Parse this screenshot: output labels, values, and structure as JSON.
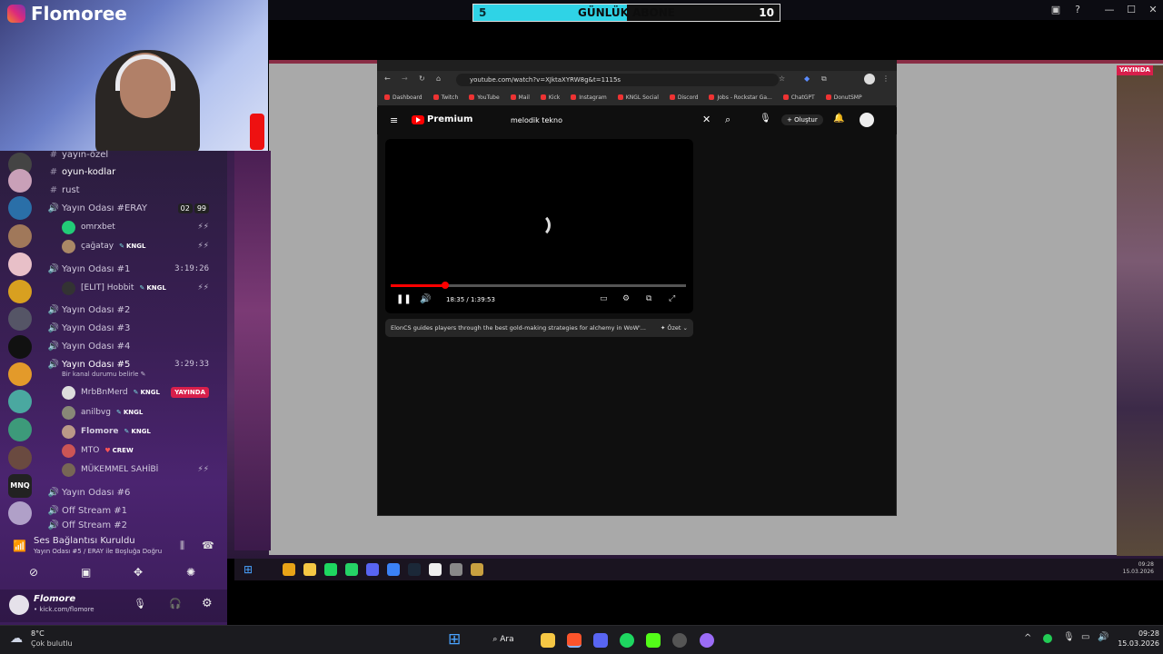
{
  "overlay": {
    "brand": "Flomoree",
    "counter": {
      "left": "5",
      "label": "GÜNLÜK ABONE",
      "right": "10",
      "progress": 0.5
    }
  },
  "discord": {
    "channels": [
      {
        "name": "yayın-özel",
        "kind": "text"
      },
      {
        "name": "oyun-kodlar",
        "kind": "text"
      },
      {
        "name": "rust",
        "kind": "text"
      },
      {
        "name": "Yayın Odası #ERAY",
        "kind": "voice",
        "badges": [
          "02",
          "99"
        ]
      },
      {
        "name": "Yayın Odası #1",
        "kind": "voice",
        "time": "3:19:26"
      },
      {
        "name": "Yayın Odası #2",
        "kind": "voice"
      },
      {
        "name": "Yayın Odası #3",
        "kind": "voice"
      },
      {
        "name": "Yayın Odası #4",
        "kind": "voice"
      },
      {
        "name": "Yayın Odası #5",
        "kind": "voice",
        "time": "3:29:33",
        "status": "Bir kanal durumu belirle"
      },
      {
        "name": "Yayın Odası #6",
        "kind": "voice"
      },
      {
        "name": "Off Stream #1",
        "kind": "voice"
      },
      {
        "name": "Off Stream #2",
        "kind": "voice"
      }
    ],
    "users": {
      "eray": [
        {
          "name": "omrxbet"
        },
        {
          "name": "çağatay",
          "tag": "KNGL"
        }
      ],
      "room1": [
        {
          "name": "[ELIT] Hobbit",
          "tag": "KNGL"
        }
      ],
      "room5": [
        {
          "name": "MrbBnMerd",
          "tag": "KNGL",
          "live": "YAYINDA"
        },
        {
          "name": "anilbvg",
          "tag": "KNGL"
        },
        {
          "name": "Flomore",
          "tag": "KNGL"
        },
        {
          "name": "MTO",
          "tag": "CREW"
        },
        {
          "name": "MÜKEMMEL SAHİBİ"
        }
      ]
    },
    "voice_status": {
      "title": "Ses Bağlantısı Kuruldu",
      "subtitle": "Yayın Odası #5 / ERAY ile Boşluğa Doğru"
    },
    "user": {
      "name": "Flomore",
      "status": "• kick.com/flomore"
    }
  },
  "browser": {
    "url": "youtube.com/watch?v=XJktaXYRW8g&t=1115s",
    "bookmarks": [
      "Dashboard",
      "Twitch",
      "YouTube",
      "Mail",
      "Kick",
      "Instagram",
      "KNGL Social",
      "Discord",
      "Jobs - Rockstar Ga...",
      "ChatGPT",
      "DonutSMP"
    ],
    "yt": {
      "logo": "Premium",
      "search": "melodik tekno",
      "create_label": "Oluştur",
      "time": "18:35 / 1:39:53",
      "progress": 0.186,
      "summary": "ElonCS guides players through the best gold-making strategies for alchemy in WoW'...",
      "summary_btn": "Özet"
    },
    "overlay_live": "YAYINDA"
  },
  "taskbar": {
    "weather_temp": "8°C",
    "weather_desc": "Çok bulutlu",
    "search_label": "Ara",
    "clock_time": "09:28",
    "clock_date": "15.03.2026"
  },
  "inner_taskbar": {
    "clock_time": "09:28",
    "clock_date": "15.03.2026"
  },
  "colors": {
    "accent": "#2fd3e6",
    "live": "#d81f4b",
    "yt_red": "#ff0000",
    "voice": "#43b581"
  }
}
